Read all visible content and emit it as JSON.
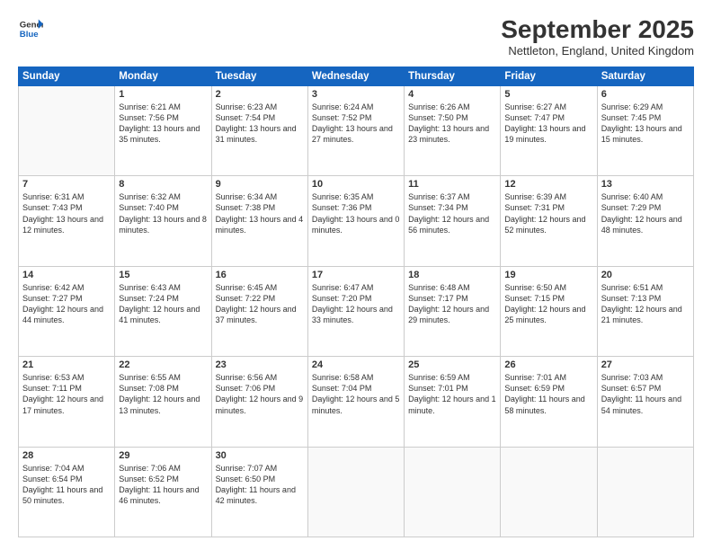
{
  "header": {
    "logo_line1": "General",
    "logo_line2": "Blue",
    "month": "September 2025",
    "location": "Nettleton, England, United Kingdom"
  },
  "weekdays": [
    "Sunday",
    "Monday",
    "Tuesday",
    "Wednesday",
    "Thursday",
    "Friday",
    "Saturday"
  ],
  "weeks": [
    [
      {
        "day": "",
        "sunrise": "",
        "sunset": "",
        "daylight": ""
      },
      {
        "day": "1",
        "sunrise": "Sunrise: 6:21 AM",
        "sunset": "Sunset: 7:56 PM",
        "daylight": "Daylight: 13 hours and 35 minutes."
      },
      {
        "day": "2",
        "sunrise": "Sunrise: 6:23 AM",
        "sunset": "Sunset: 7:54 PM",
        "daylight": "Daylight: 13 hours and 31 minutes."
      },
      {
        "day": "3",
        "sunrise": "Sunrise: 6:24 AM",
        "sunset": "Sunset: 7:52 PM",
        "daylight": "Daylight: 13 hours and 27 minutes."
      },
      {
        "day": "4",
        "sunrise": "Sunrise: 6:26 AM",
        "sunset": "Sunset: 7:50 PM",
        "daylight": "Daylight: 13 hours and 23 minutes."
      },
      {
        "day": "5",
        "sunrise": "Sunrise: 6:27 AM",
        "sunset": "Sunset: 7:47 PM",
        "daylight": "Daylight: 13 hours and 19 minutes."
      },
      {
        "day": "6",
        "sunrise": "Sunrise: 6:29 AM",
        "sunset": "Sunset: 7:45 PM",
        "daylight": "Daylight: 13 hours and 15 minutes."
      }
    ],
    [
      {
        "day": "7",
        "sunrise": "Sunrise: 6:31 AM",
        "sunset": "Sunset: 7:43 PM",
        "daylight": "Daylight: 13 hours and 12 minutes."
      },
      {
        "day": "8",
        "sunrise": "Sunrise: 6:32 AM",
        "sunset": "Sunset: 7:40 PM",
        "daylight": "Daylight: 13 hours and 8 minutes."
      },
      {
        "day": "9",
        "sunrise": "Sunrise: 6:34 AM",
        "sunset": "Sunset: 7:38 PM",
        "daylight": "Daylight: 13 hours and 4 minutes."
      },
      {
        "day": "10",
        "sunrise": "Sunrise: 6:35 AM",
        "sunset": "Sunset: 7:36 PM",
        "daylight": "Daylight: 13 hours and 0 minutes."
      },
      {
        "day": "11",
        "sunrise": "Sunrise: 6:37 AM",
        "sunset": "Sunset: 7:34 PM",
        "daylight": "Daylight: 12 hours and 56 minutes."
      },
      {
        "day": "12",
        "sunrise": "Sunrise: 6:39 AM",
        "sunset": "Sunset: 7:31 PM",
        "daylight": "Daylight: 12 hours and 52 minutes."
      },
      {
        "day": "13",
        "sunrise": "Sunrise: 6:40 AM",
        "sunset": "Sunset: 7:29 PM",
        "daylight": "Daylight: 12 hours and 48 minutes."
      }
    ],
    [
      {
        "day": "14",
        "sunrise": "Sunrise: 6:42 AM",
        "sunset": "Sunset: 7:27 PM",
        "daylight": "Daylight: 12 hours and 44 minutes."
      },
      {
        "day": "15",
        "sunrise": "Sunrise: 6:43 AM",
        "sunset": "Sunset: 7:24 PM",
        "daylight": "Daylight: 12 hours and 41 minutes."
      },
      {
        "day": "16",
        "sunrise": "Sunrise: 6:45 AM",
        "sunset": "Sunset: 7:22 PM",
        "daylight": "Daylight: 12 hours and 37 minutes."
      },
      {
        "day": "17",
        "sunrise": "Sunrise: 6:47 AM",
        "sunset": "Sunset: 7:20 PM",
        "daylight": "Daylight: 12 hours and 33 minutes."
      },
      {
        "day": "18",
        "sunrise": "Sunrise: 6:48 AM",
        "sunset": "Sunset: 7:17 PM",
        "daylight": "Daylight: 12 hours and 29 minutes."
      },
      {
        "day": "19",
        "sunrise": "Sunrise: 6:50 AM",
        "sunset": "Sunset: 7:15 PM",
        "daylight": "Daylight: 12 hours and 25 minutes."
      },
      {
        "day": "20",
        "sunrise": "Sunrise: 6:51 AM",
        "sunset": "Sunset: 7:13 PM",
        "daylight": "Daylight: 12 hours and 21 minutes."
      }
    ],
    [
      {
        "day": "21",
        "sunrise": "Sunrise: 6:53 AM",
        "sunset": "Sunset: 7:11 PM",
        "daylight": "Daylight: 12 hours and 17 minutes."
      },
      {
        "day": "22",
        "sunrise": "Sunrise: 6:55 AM",
        "sunset": "Sunset: 7:08 PM",
        "daylight": "Daylight: 12 hours and 13 minutes."
      },
      {
        "day": "23",
        "sunrise": "Sunrise: 6:56 AM",
        "sunset": "Sunset: 7:06 PM",
        "daylight": "Daylight: 12 hours and 9 minutes."
      },
      {
        "day": "24",
        "sunrise": "Sunrise: 6:58 AM",
        "sunset": "Sunset: 7:04 PM",
        "daylight": "Daylight: 12 hours and 5 minutes."
      },
      {
        "day": "25",
        "sunrise": "Sunrise: 6:59 AM",
        "sunset": "Sunset: 7:01 PM",
        "daylight": "Daylight: 12 hours and 1 minute."
      },
      {
        "day": "26",
        "sunrise": "Sunrise: 7:01 AM",
        "sunset": "Sunset: 6:59 PM",
        "daylight": "Daylight: 11 hours and 58 minutes."
      },
      {
        "day": "27",
        "sunrise": "Sunrise: 7:03 AM",
        "sunset": "Sunset: 6:57 PM",
        "daylight": "Daylight: 11 hours and 54 minutes."
      }
    ],
    [
      {
        "day": "28",
        "sunrise": "Sunrise: 7:04 AM",
        "sunset": "Sunset: 6:54 PM",
        "daylight": "Daylight: 11 hours and 50 minutes."
      },
      {
        "day": "29",
        "sunrise": "Sunrise: 7:06 AM",
        "sunset": "Sunset: 6:52 PM",
        "daylight": "Daylight: 11 hours and 46 minutes."
      },
      {
        "day": "30",
        "sunrise": "Sunrise: 7:07 AM",
        "sunset": "Sunset: 6:50 PM",
        "daylight": "Daylight: 11 hours and 42 minutes."
      },
      {
        "day": "",
        "sunrise": "",
        "sunset": "",
        "daylight": ""
      },
      {
        "day": "",
        "sunrise": "",
        "sunset": "",
        "daylight": ""
      },
      {
        "day": "",
        "sunrise": "",
        "sunset": "",
        "daylight": ""
      },
      {
        "day": "",
        "sunrise": "",
        "sunset": "",
        "daylight": ""
      }
    ]
  ]
}
